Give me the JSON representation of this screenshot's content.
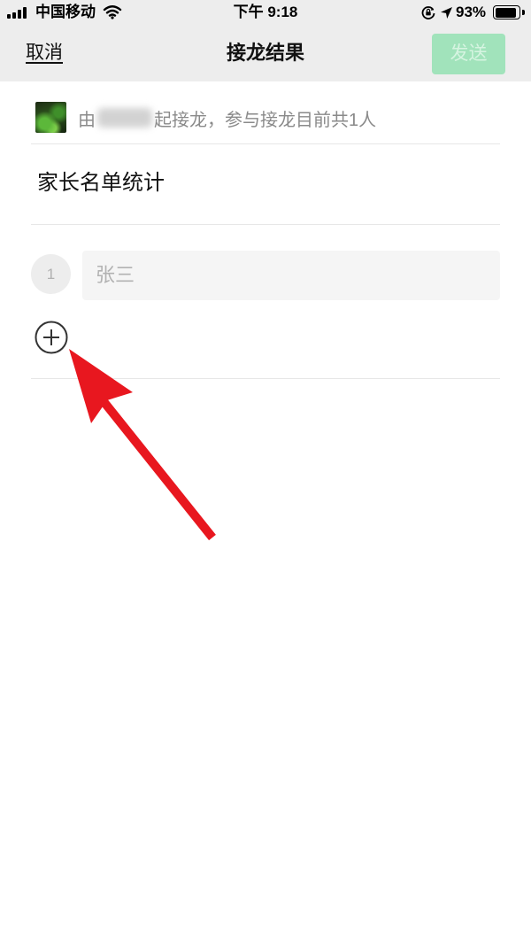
{
  "status_bar": {
    "carrier": "中国移动",
    "time": "下午 9:18",
    "battery": "93%",
    "battery_level": 0.93,
    "icons": [
      "signal-icon",
      "wifi-icon",
      "orientation-lock-icon",
      "location-icon",
      "battery-icon"
    ]
  },
  "nav": {
    "cancel_label": "取消",
    "title": "接龙结果",
    "send_label": "发送"
  },
  "initiator": {
    "prefix": "由",
    "suffix": "起接龙，参与接龙目前共1人"
  },
  "topic": "家长名单统计",
  "entries": [
    {
      "index": "1",
      "placeholder": "张三"
    }
  ],
  "add_icon": "plus-circle-icon",
  "colors": {
    "nav_bg": "#ededed",
    "send_button_bg": "#a1e3bb",
    "send_button_text": "#d6f4e1",
    "annotation_arrow": "#e8171f"
  }
}
